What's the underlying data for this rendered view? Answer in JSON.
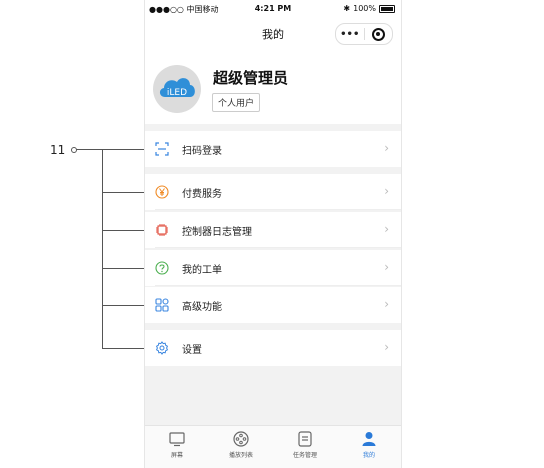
{
  "annotation": {
    "label": "11"
  },
  "status_bar": {
    "carrier": "●●●○○ 中国移动",
    "time": "4:21 PM",
    "battery": "100%"
  },
  "nav": {
    "title": "我的",
    "menu_dots": "•••"
  },
  "profile": {
    "avatar_text": "iLED",
    "name": "超级管理员",
    "tag": "个人用户"
  },
  "menu": [
    {
      "label": "扫码登录",
      "icon": "scan-icon",
      "color": "#3a86e0"
    },
    {
      "label": "付费服务",
      "icon": "yen-icon",
      "color": "#f08a24"
    },
    {
      "label": "控制器日志管理",
      "icon": "chip-icon",
      "color": "#e04a3a"
    },
    {
      "label": "我的工单",
      "icon": "question-icon",
      "color": "#4caf50"
    },
    {
      "label": "高级功能",
      "icon": "grid-icon",
      "color": "#3a86e0"
    },
    {
      "label": "设置",
      "icon": "gear-icon",
      "color": "#3a86e0"
    }
  ],
  "tabs": [
    {
      "label": "屏幕",
      "icon": "screen-icon"
    },
    {
      "label": "播放列表",
      "icon": "playlist-icon"
    },
    {
      "label": "任务管理",
      "icon": "task-icon"
    },
    {
      "label": "我的",
      "icon": "user-icon",
      "active": true
    }
  ],
  "colors": {
    "accent": "#2a7ad8",
    "avatar_blue": "#2f8fd8"
  }
}
